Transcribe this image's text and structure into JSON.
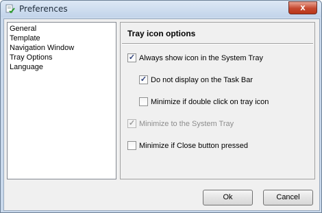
{
  "window": {
    "title": "Preferences",
    "close_label": "x"
  },
  "nav": {
    "items": [
      {
        "label": "General"
      },
      {
        "label": "Template"
      },
      {
        "label": "Navigation Window"
      },
      {
        "label": "Tray Options"
      },
      {
        "label": "Language"
      }
    ]
  },
  "panel": {
    "title": "Tray icon options",
    "options": [
      {
        "label": "Always show icon in the System Tray",
        "checked": true,
        "enabled": true
      },
      {
        "label": "Do not display on the Task Bar",
        "checked": true,
        "enabled": true
      },
      {
        "label": "Minimize if double click on tray icon",
        "checked": false,
        "enabled": true
      },
      {
        "label": "Minimize to the System Tray",
        "checked": true,
        "enabled": false
      },
      {
        "label": "Minimize if Close button pressed",
        "checked": false,
        "enabled": true
      }
    ]
  },
  "buttons": {
    "ok": "Ok",
    "cancel": "Cancel"
  },
  "check_mark": "✓"
}
